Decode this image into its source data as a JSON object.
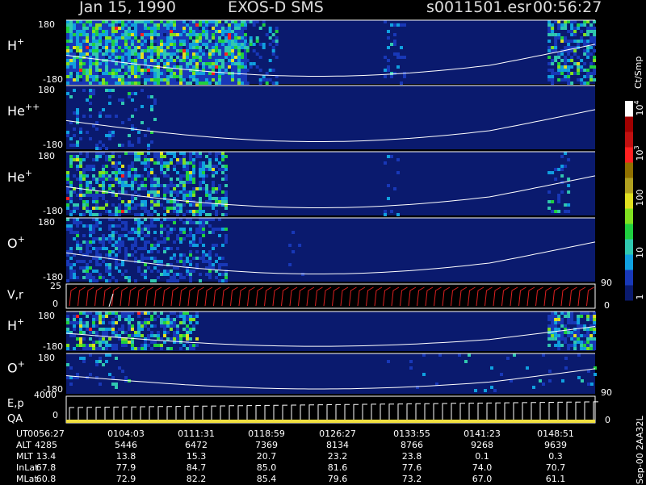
{
  "header": {
    "date": "Jan 15, 1990",
    "instrument": "EXOS-D SMS",
    "file": "s0011501.esr",
    "time": "00:56:27"
  },
  "colors": {
    "background": "#000000",
    "panel_bg": "#0a1a6e",
    "trace": "#ffffff",
    "velocity": "#e02020"
  },
  "colorbar": {
    "title": "Ct/Smp",
    "scale": "log",
    "range": [
      1,
      10000
    ],
    "ticks": [
      "1",
      "10",
      "100",
      "10",
      "10"
    ],
    "tick_exponents": [
      "",
      "",
      "",
      "3",
      "4"
    ],
    "colors": [
      "#0a1a6e",
      "#1838b8",
      "#10a0e0",
      "#30c8b0",
      "#20d040",
      "#80e020",
      "#e0e020",
      "#b0a020",
      "#907000",
      "#ff2020",
      "#c01010",
      "#a00000",
      "#ffffff"
    ]
  },
  "chart_data": {
    "type": "heatmap",
    "time_axis_label": "UT",
    "time_ticks": [
      "00:56:27",
      "01:04:03",
      "01:11:31",
      "01:18:59",
      "01:26:27",
      "01:33:55",
      "01:41:23",
      "01:48:51"
    ],
    "panels": [
      {
        "label": "H",
        "charge": "+",
        "ylim": [
          -180,
          180
        ],
        "tick_top": "180",
        "tick_bottom": "-180",
        "activity": [
          [
            0.0,
            0.34,
            0.95
          ],
          [
            0.34,
            0.4,
            0.35
          ],
          [
            0.6,
            0.64,
            0.25
          ],
          [
            0.91,
            1.0,
            0.6
          ]
        ]
      },
      {
        "label": "He",
        "charge": "++",
        "ylim": [
          -180,
          180
        ],
        "tick_top": "180",
        "tick_bottom": "-180",
        "activity": [
          [
            0.0,
            0.17,
            0.18
          ]
        ]
      },
      {
        "label": "He",
        "charge": "+",
        "ylim": [
          -180,
          180
        ],
        "tick_top": "180",
        "tick_bottom": "-180",
        "activity": [
          [
            0.0,
            0.3,
            0.55
          ],
          [
            0.6,
            0.63,
            0.12
          ],
          [
            0.91,
            0.95,
            0.25
          ]
        ]
      },
      {
        "label": "O",
        "charge": "+",
        "ylim": [
          -180,
          180
        ],
        "tick_top": "180",
        "tick_bottom": "-180",
        "activity": [
          [
            0.0,
            0.3,
            0.45
          ],
          [
            0.42,
            0.45,
            0.08
          ]
        ]
      },
      {
        "label": "H",
        "charge": "+",
        "ylim": [
          -180,
          180
        ],
        "tick_top": "180",
        "tick_bottom": "-180",
        "activity": [
          [
            0.0,
            0.25,
            0.55
          ],
          [
            0.91,
            1.0,
            0.6
          ]
        ]
      },
      {
        "label": "O",
        "charge": "+",
        "ylim": [
          -180,
          180
        ],
        "tick_top": "180",
        "tick_bottom": "-180",
        "activity": [
          [
            0.0,
            0.12,
            0.12
          ],
          [
            0.6,
            1.0,
            0.05
          ]
        ]
      }
    ],
    "velocity_panel": {
      "label": "V,r",
      "tick_top": "25",
      "tick_mid": "0",
      "right_tick_top": "90",
      "right_tick_bottom": "0"
    },
    "energy_panel": {
      "label_top": "E,p",
      "label_bottom": "QA",
      "tick_top": "4000",
      "tick_mid": "0",
      "right_tick": "90"
    }
  },
  "ephemeris": {
    "rows": [
      {
        "label": "UT",
        "values": [
          "0056:27",
          "0104:03",
          "0111:31",
          "0118:59",
          "0126:27",
          "0133:55",
          "0141:23",
          "0148:51"
        ]
      },
      {
        "label": "ALT",
        "values": [
          "4285",
          "5446",
          "6472",
          "7369",
          "8134",
          "8766",
          "9268",
          "9639"
        ]
      },
      {
        "label": "MLT",
        "values": [
          "13.4",
          "13.8",
          "15.3",
          "20.7",
          "23.2",
          "23.8",
          "0.1",
          "0.3"
        ]
      },
      {
        "label": "InLat",
        "values": [
          "67.8",
          "77.9",
          "84.7",
          "85.0",
          "81.6",
          "77.6",
          "74.0",
          "70.7"
        ]
      },
      {
        "label": "MLat",
        "values": [
          "60.8",
          "72.9",
          "82.2",
          "85.4",
          "79.6",
          "73.2",
          "67.0",
          "61.1"
        ]
      }
    ]
  },
  "credit": "Sep-00  2AA32L"
}
